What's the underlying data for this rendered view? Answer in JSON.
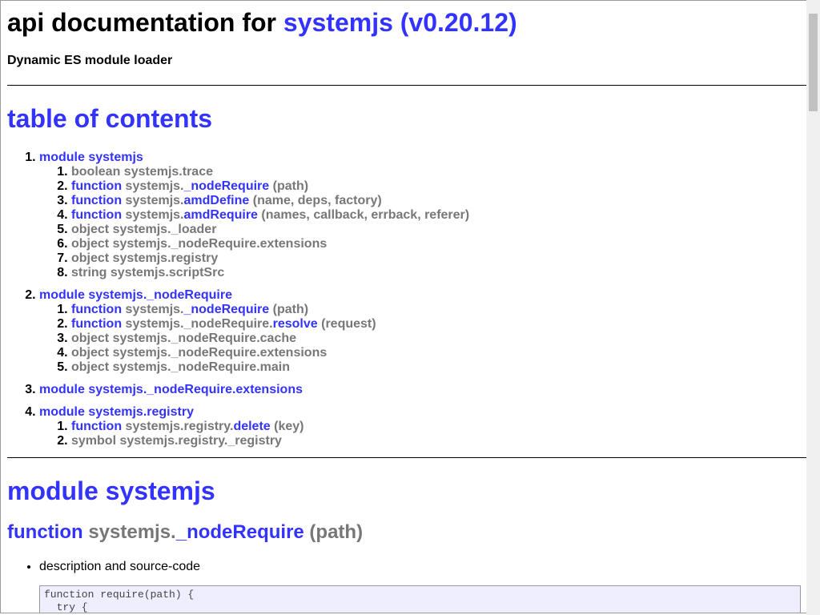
{
  "header": {
    "title_prefix": "api documentation for",
    "title_link": "systemjs (v0.20.12)",
    "description": "Dynamic ES module loader"
  },
  "toc": {
    "heading": "table of contents",
    "modules": [
      {
        "label": "module systemjs",
        "members": [
          {
            "kind": "boolean",
            "path": "systemjs.trace"
          },
          {
            "kind": "function",
            "path": "systemjs.",
            "name": "_nodeRequire",
            "args": "(path)"
          },
          {
            "kind": "function",
            "path": "systemjs.",
            "name": "amdDefine",
            "args": "(name, deps, factory)"
          },
          {
            "kind": "function",
            "path": "systemjs.",
            "name": "amdRequire",
            "args": "(names, callback, errback, referer)"
          },
          {
            "kind": "object",
            "path": "systemjs._loader"
          },
          {
            "kind": "object",
            "path": "systemjs._nodeRequire.extensions"
          },
          {
            "kind": "object",
            "path": "systemjs.registry"
          },
          {
            "kind": "string",
            "path": "systemjs.scriptSrc"
          }
        ]
      },
      {
        "label": "module systemjs._nodeRequire",
        "members": [
          {
            "kind": "function",
            "path": "systemjs.",
            "name": "_nodeRequire",
            "args": "(path)"
          },
          {
            "kind": "function",
            "path": "systemjs._nodeRequire.",
            "name": "resolve",
            "args": "(request)"
          },
          {
            "kind": "object",
            "path": "systemjs._nodeRequire.cache"
          },
          {
            "kind": "object",
            "path": "systemjs._nodeRequire.extensions"
          },
          {
            "kind": "object",
            "path": "systemjs._nodeRequire.main"
          }
        ]
      },
      {
        "label": "module systemjs._nodeRequire.extensions",
        "members": []
      },
      {
        "label": "module systemjs.registry",
        "members": [
          {
            "kind": "function",
            "path": "systemjs.registry.",
            "name": "delete",
            "args": "(key)"
          },
          {
            "kind": "symbol",
            "path": "systemjs.registry._registry"
          }
        ]
      }
    ]
  },
  "module_section": {
    "heading": "module systemjs",
    "function_heading": {
      "kind": "function",
      "path": "systemjs.",
      "name": "_nodeRequire",
      "args": "(path)"
    },
    "details_label": "description and source-code",
    "code": "function require(path) {\n  try {"
  }
}
